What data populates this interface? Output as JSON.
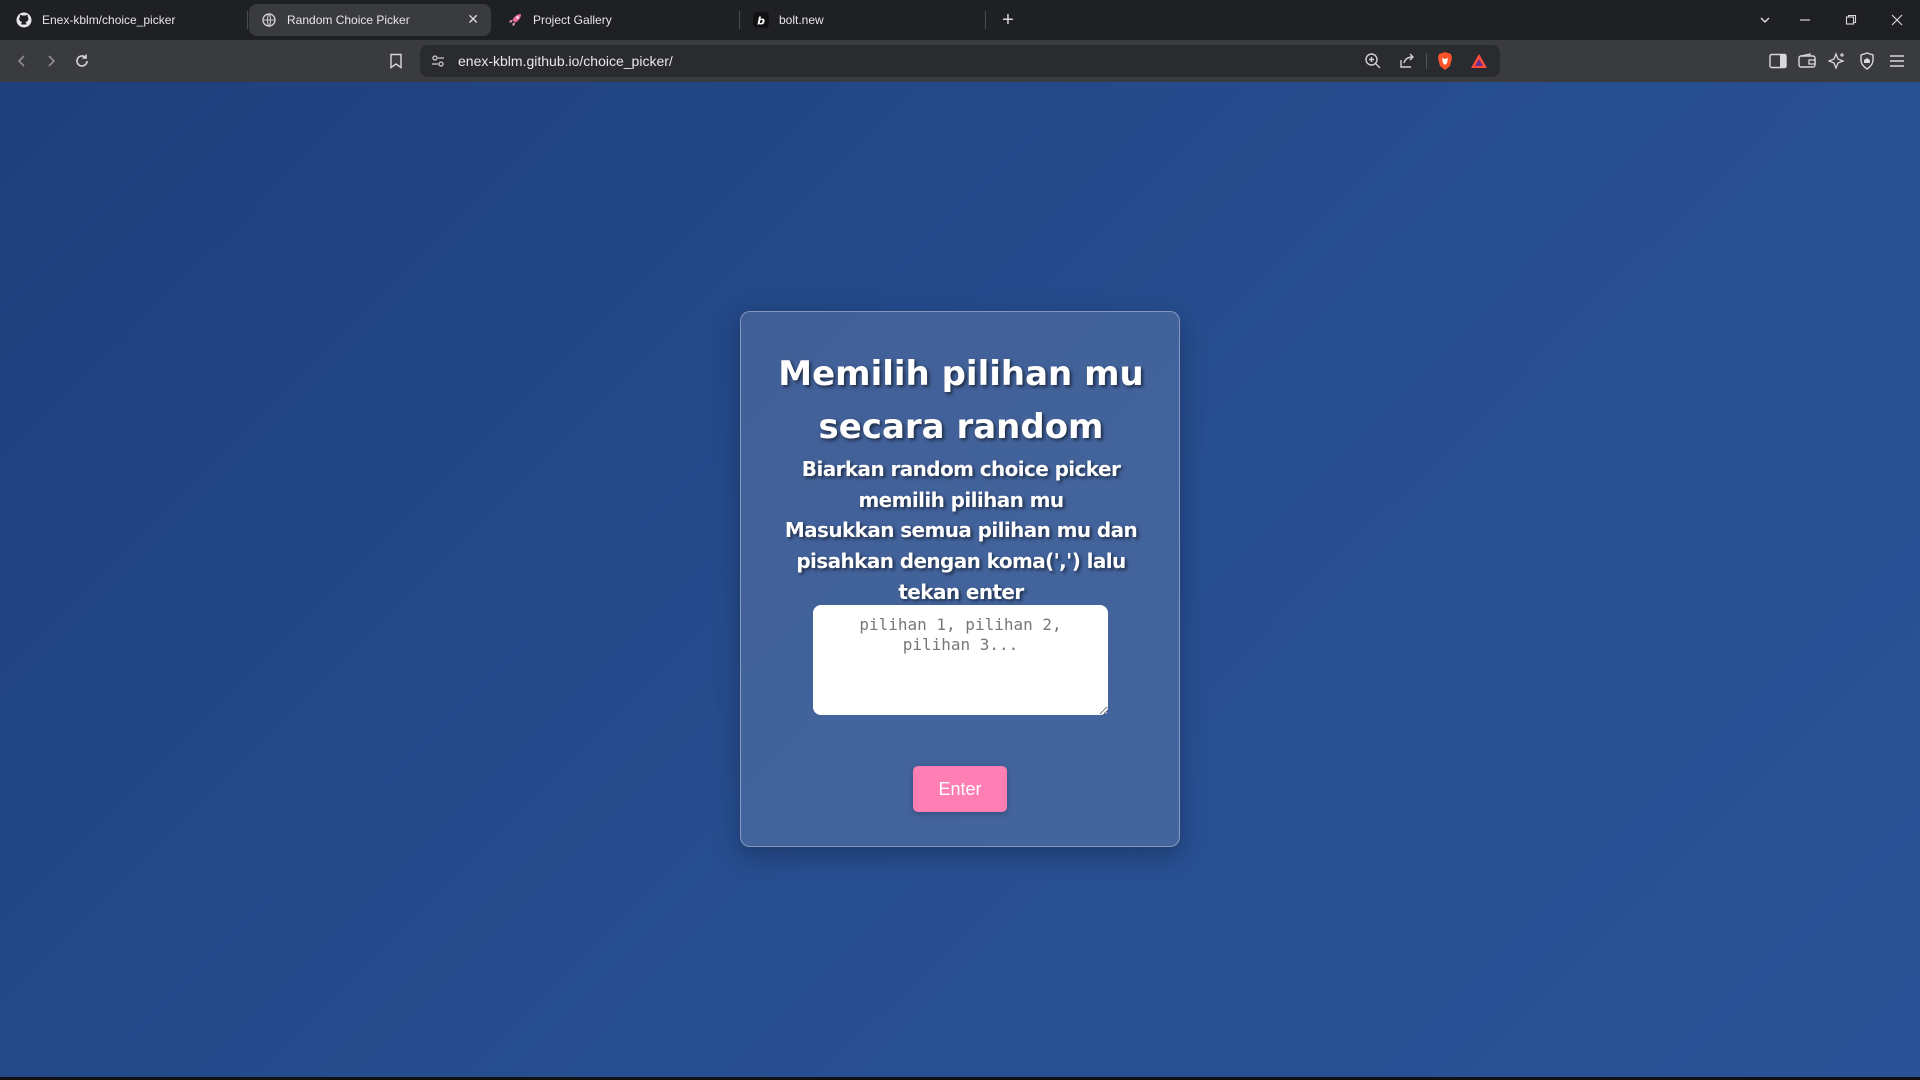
{
  "browser": {
    "tabs": [
      {
        "title": "Enex-kblm/choice_picker",
        "icon": "github-icon"
      },
      {
        "title": "Random Choice Picker",
        "icon": "globe-icon",
        "active": true
      },
      {
        "title": "Project Gallery",
        "icon": "rocket-icon"
      },
      {
        "title": "bolt.new",
        "icon": "bolt-icon"
      }
    ],
    "url": "enex-kblm.github.io/choice_picker/"
  },
  "app": {
    "title_line1": "Memilih pilihan mu",
    "title_line2": "secara random",
    "subtitle1": "Biarkan random choice picker memilih pilihan mu",
    "subtitle2": "Masukkan semua pilihan mu dan pisahkan dengan koma(',') lalu tekan enter",
    "textarea_placeholder": "pilihan 1, pilihan 2, pilihan 3...",
    "enter_label": "Enter",
    "colors": {
      "background": "#234a8c",
      "button": "#ff7eb3",
      "card": "#3f5d94"
    }
  }
}
